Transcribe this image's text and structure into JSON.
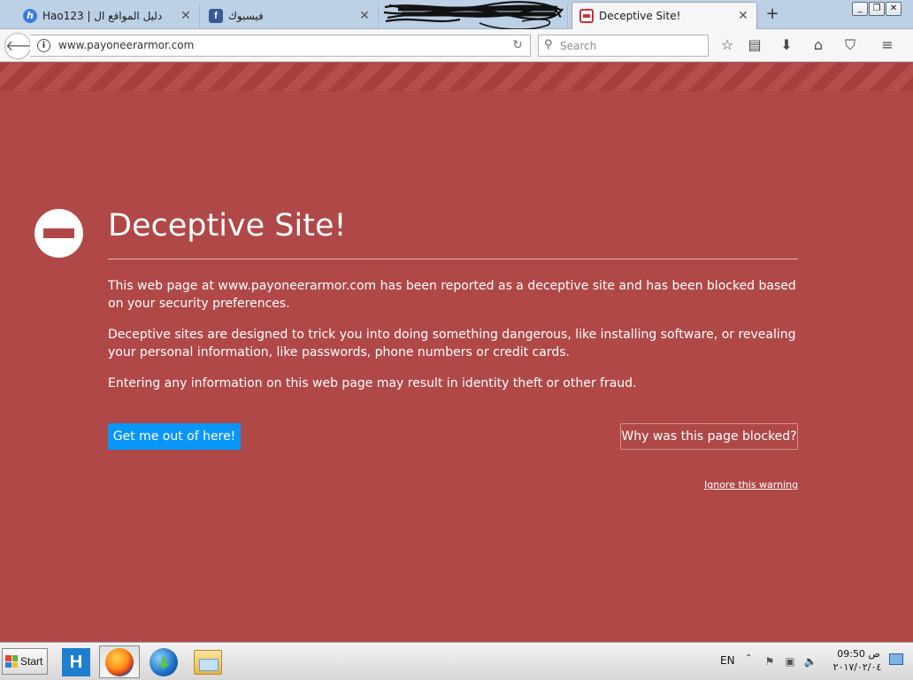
{
  "browser": {
    "tabs": [
      {
        "label": "Hao123 | دليل المواقع ال",
        "favicon": "hao123-icon",
        "active": false
      },
      {
        "label": "فيسبوك",
        "favicon": "facebook-icon",
        "active": false
      },
      {
        "label": "",
        "favicon": "",
        "active": false
      },
      {
        "label": "Deceptive Site!",
        "favicon": "blocked-site-icon",
        "active": true
      }
    ],
    "new_tab": "+",
    "window_controls": {
      "minimize": "_",
      "restore": "❐",
      "close": "✕"
    },
    "url": "www.payoneerarmor.com",
    "search_placeholder": "Search"
  },
  "page": {
    "title": "Deceptive Site!",
    "paragraph1": "This web page at www.payoneerarmor.com has been reported as a deceptive site and has been blocked based on your security preferences.",
    "paragraph2": "Deceptive sites are designed to trick you into doing something dangerous, like installing software, or revealing your personal information, like passwords, phone numbers or credit cards.",
    "paragraph3": "Entering any information on this web page may result in identity theft or other fraud.",
    "primary_button": "Get me out of here!",
    "secondary_button": "Why was this page blocked?",
    "ignore_link": "Ignore this warning",
    "colors": {
      "background": "#b04848",
      "primary_button": "#0996f8"
    }
  },
  "taskbar": {
    "start_label": "Start",
    "apps": [
      "hao123-app-icon",
      "firefox-icon",
      "internet-download-manager-icon",
      "file-explorer-icon"
    ],
    "language": "EN",
    "clock_time": "09:50 ص",
    "clock_date": "٢٠١٧/٠٢/٠٤"
  }
}
